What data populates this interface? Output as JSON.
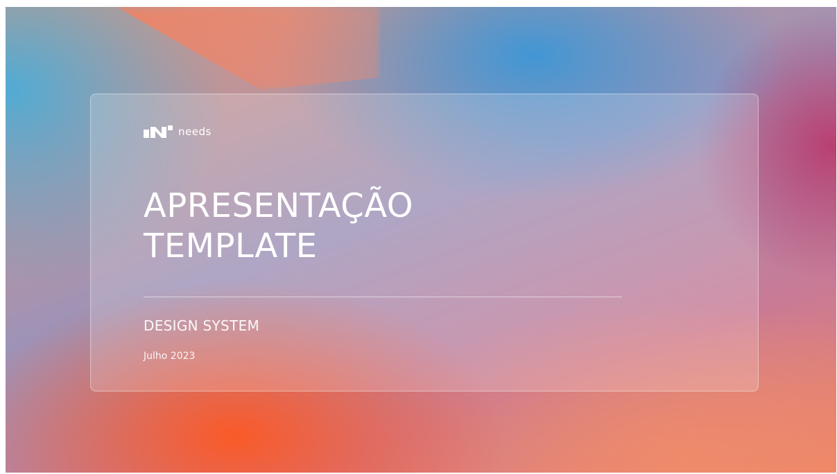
{
  "brand": {
    "logo_icon": "needs-logo-icon",
    "name": "needs"
  },
  "slide": {
    "title_line1": "APRESENTAÇÃO",
    "title_line2": "TEMPLATE",
    "subtitle": "DESIGN SYSTEM",
    "date": "Julho 2023"
  },
  "colors": {
    "text": "#ffffff",
    "orange": "#fa5a28",
    "blue": "#3c96d7",
    "magenta": "#b93c6e"
  }
}
